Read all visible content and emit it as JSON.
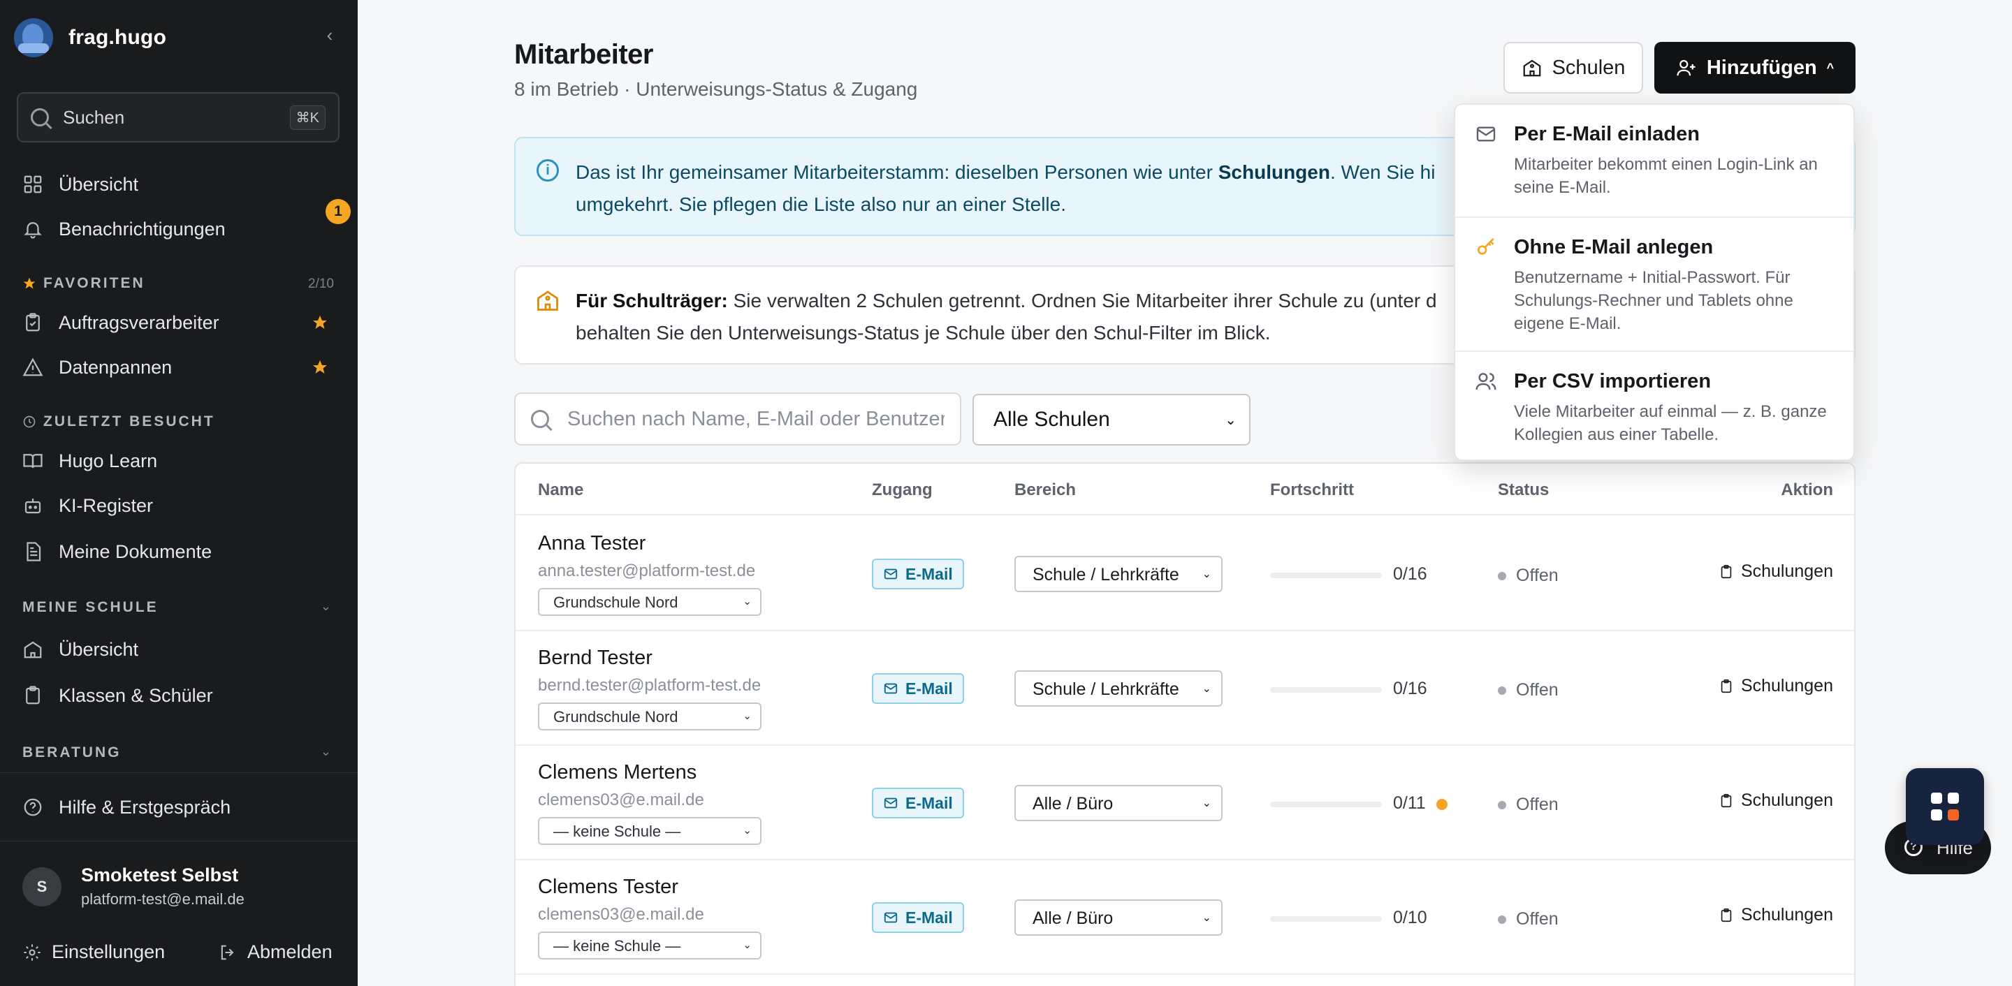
{
  "brand": {
    "name": "frag.hugo"
  },
  "sidebar": {
    "search_label": "Suchen",
    "search_kbd": "⌘K",
    "nav_top": [
      {
        "label": "Übersicht",
        "icon": "dashboard-icon"
      },
      {
        "label": "Benachrichtigungen",
        "icon": "bell-icon",
        "badge": "1"
      }
    ],
    "favorites": {
      "title": "FAVORITEN",
      "count": "2/10",
      "items": [
        {
          "label": "Auftragsverarbeiter",
          "icon": "clipboard-icon"
        },
        {
          "label": "Datenpannen",
          "icon": "warning-icon"
        }
      ]
    },
    "recent": {
      "title": "ZULETZT BESUCHT",
      "items": [
        {
          "label": "Hugo Learn",
          "icon": "book-icon"
        },
        {
          "label": "KI-Register",
          "icon": "robot-icon"
        },
        {
          "label": "Meine Dokumente",
          "icon": "document-icon"
        }
      ]
    },
    "school": {
      "title": "MEINE SCHULE",
      "items": [
        {
          "label": "Übersicht",
          "icon": "school-icon"
        },
        {
          "label": "Klassen & Schüler",
          "icon": "clipboard-icon"
        }
      ]
    },
    "consulting": {
      "title": "BERATUNG"
    },
    "help_item": "Hilfe & Erstgespräch",
    "user": {
      "initial": "S",
      "name": "Smoketest Selbst",
      "email": "platform-test@e.mail.de"
    },
    "settings_label": "Einstellungen",
    "logout_label": "Abmelden"
  },
  "header": {
    "title": "Mitarbeiter",
    "subtitle": "8 im Betrieb · Unterweisungs-Status & Zugang",
    "schools_button": "Schulen",
    "add_button": "Hinzufügen"
  },
  "info": {
    "text_1": "Das ist Ihr gemeinsamer Mitarbeiterstamm: dieselben Personen wie unter ",
    "link": "Schulungen",
    "text_2": ". Wen Sie hi",
    "text_3": "umgekehrt. Sie pflegen die Liste also nur an einer Stelle."
  },
  "note": {
    "bold": "Für Schulträger:",
    "text_1": " Sie verwalten 2 Schulen getrennt. Ordnen Sie Mitarbeiter ihrer Schule zu (unter d",
    "text_2": "behalten Sie den Unterweisungs-Status je Schule über den Schul-Filter im Blick."
  },
  "filters": {
    "search_placeholder": "Suchen nach Name, E-Mail oder Benutzer",
    "school_filter": "Alle Schulen"
  },
  "table": {
    "headers": {
      "name": "Name",
      "access": "Zugang",
      "area": "Bereich",
      "progress": "Fortschritt",
      "status": "Status",
      "action": "Aktion"
    },
    "rows": [
      {
        "name": "Anna Tester",
        "email": "anna.tester@platform-test.de",
        "school": "Grundschule Nord",
        "access": "E-Mail",
        "area": "Schule / Lehrkräfte",
        "progress": "0/16",
        "progress_fraction": 0,
        "warn": false,
        "status": "Offen",
        "action": "Schulungen"
      },
      {
        "name": "Bernd Tester",
        "email": "bernd.tester@platform-test.de",
        "school": "Grundschule Nord",
        "access": "E-Mail",
        "area": "Schule / Lehrkräfte",
        "progress": "0/16",
        "progress_fraction": 0,
        "warn": false,
        "status": "Offen",
        "action": "Schulungen"
      },
      {
        "name": "Clemens Mertens",
        "email": "clemens03@e.mail.de",
        "school": "— keine Schule —",
        "access": "E-Mail",
        "area": "Alle / Büro",
        "progress": "0/11",
        "progress_fraction": 0,
        "warn": true,
        "status": "Offen",
        "action": "Schulungen"
      },
      {
        "name": "Clemens Tester",
        "email": "clemens03@e.mail.de",
        "school": "— keine Schule —",
        "access": "E-Mail",
        "area": "Alle / Büro",
        "progress": "0/10",
        "progress_fraction": 0,
        "warn": false,
        "status": "Offen",
        "action": "Schulungen"
      }
    ]
  },
  "add_menu": [
    {
      "title": "Per E-Mail einladen",
      "desc": "Mitarbeiter bekommt einen Login-Link an seine E-Mail.",
      "icon": "mail-icon"
    },
    {
      "title": "Ohne E-Mail anlegen",
      "desc": "Benutzername + Initial-Passwort. Für Schulungs-Rechner und Tablets ohne eigene E-Mail.",
      "icon": "key-icon"
    },
    {
      "title": "Per CSV importieren",
      "desc": "Viele Mitarbeiter auf einmal — z. B. ganze Kollegien aus einer Tabelle.",
      "icon": "users-icon"
    }
  ],
  "help_button": "Hilfe",
  "colors": {
    "accent": "#2d8fbc",
    "warning": "#f5a623",
    "sidebar_bg": "#1a1b1d",
    "primary_button": "#111214"
  }
}
